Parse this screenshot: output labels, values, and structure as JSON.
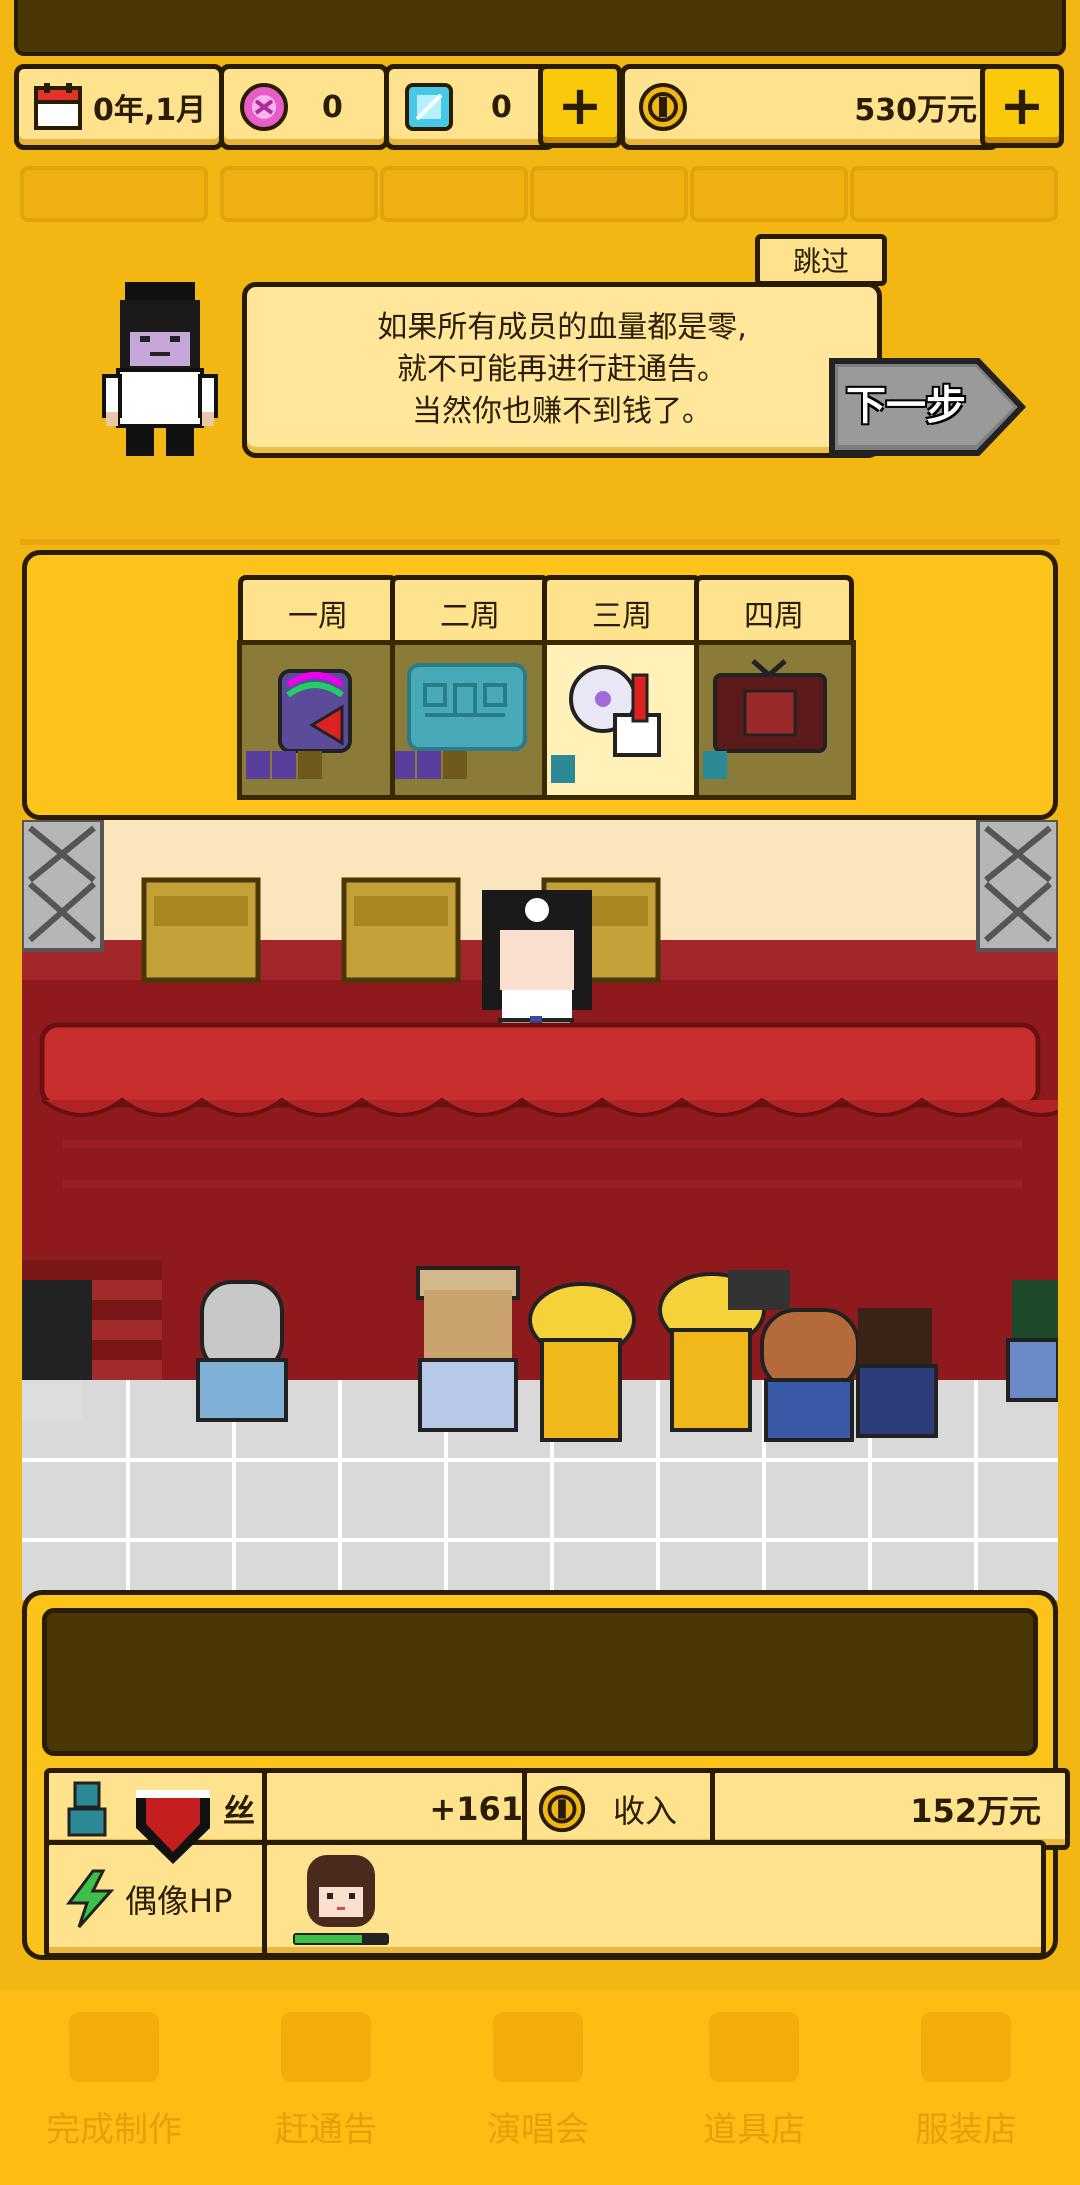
{
  "status": {
    "date": "0年,1月",
    "pink_gems": "0",
    "blue_gems": "0",
    "money": "530万元",
    "plus_label": "+"
  },
  "tutorial": {
    "skip_label": "跳过",
    "line1": "如果所有成员的血量都是零,",
    "line2": "就不可能再进行赶通告。",
    "line3": "当然你也赚不到钱了。",
    "next_label": "下一步"
  },
  "weeks": [
    {
      "label": "一周"
    },
    {
      "label": "二周"
    },
    {
      "label": "三周"
    },
    {
      "label": "四周"
    }
  ],
  "stats": {
    "fans_label": "丝",
    "fans_value": "+161",
    "income_label": "收入",
    "income_value": "152万元",
    "idol_hp_label": "偶像HP"
  },
  "nav": [
    {
      "label": "完成制作"
    },
    {
      "label": "赶通告"
    },
    {
      "label": "演唱会"
    },
    {
      "label": "道具店"
    },
    {
      "label": "服装店"
    }
  ],
  "colors": {
    "background": "#f2b713",
    "panel": "#fcc41b",
    "cream": "#ffe28e",
    "outline": "#2a1c00",
    "stage_red": "#c92e2e"
  }
}
